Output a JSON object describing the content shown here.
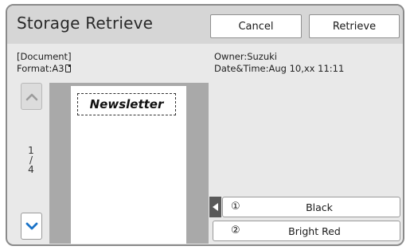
{
  "window": {
    "title": "Storage Retrieve",
    "cancel_label": "Cancel",
    "retrieve_label": "Retrieve"
  },
  "info": {
    "document_label": "[Document]",
    "format_label": "Format:A3",
    "owner": "Owner:Suzuki",
    "datetime": "Date&Time:Aug 10,xx 11:11"
  },
  "pager": {
    "current": "1",
    "separator": "/",
    "total": "4"
  },
  "preview": {
    "headline": "Newsletter"
  },
  "colors": [
    {
      "number": "①",
      "name": "Black"
    },
    {
      "number": "②",
      "name": "Bright Red"
    }
  ],
  "icons": {
    "scroll_up": "chevron-up-icon",
    "scroll_down": "chevron-down-icon",
    "color_tab": "triangle-left-icon",
    "orientation": "portrait-page-icon"
  },
  "palette": {
    "accent_blue": "#1a73c8",
    "frame_bg": "#e9e9e9",
    "title_bg": "#d6d6d6",
    "preview_bg": "#a9a9a9"
  }
}
